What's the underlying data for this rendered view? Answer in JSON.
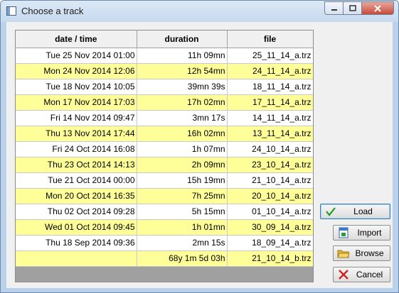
{
  "window": {
    "title": "Choose a track"
  },
  "table": {
    "columns": [
      "date / time",
      "duration",
      "file"
    ],
    "rows": [
      {
        "date": "Tue 25 Nov 2014 01:00",
        "duration": "11h 09mn",
        "file": "25_11_14_a.trz"
      },
      {
        "date": "Mon 24 Nov 2014 12:06",
        "duration": "12h 54mn",
        "file": "24_11_14_a.trz"
      },
      {
        "date": "Tue 18 Nov 2014 10:05",
        "duration": "39mn 39s",
        "file": "18_11_14_a.trz"
      },
      {
        "date": "Mon 17 Nov 2014 17:03",
        "duration": "17h 02mn",
        "file": "17_11_14_a.trz"
      },
      {
        "date": "Fri 14 Nov 2014 09:47",
        "duration": "3mn 17s",
        "file": "14_11_14_a.trz"
      },
      {
        "date": "Thu 13 Nov 2014 17:44",
        "duration": "16h 02mn",
        "file": "13_11_14_a.trz"
      },
      {
        "date": "Fri 24 Oct 2014 16:08",
        "duration": "1h 07mn",
        "file": "24_10_14_a.trz"
      },
      {
        "date": "Thu 23 Oct 2014 14:13",
        "duration": "2h 09mn",
        "file": "23_10_14_a.trz"
      },
      {
        "date": "Tue 21 Oct 2014 00:00",
        "duration": "15h 19mn",
        "file": "21_10_14_a.trz"
      },
      {
        "date": "Mon 20 Oct 2014 16:35",
        "duration": "7h 25mn",
        "file": "20_10_14_a.trz"
      },
      {
        "date": "Thu 02 Oct 2014 09:28",
        "duration": "5h 15mn",
        "file": "01_10_14_a.trz"
      },
      {
        "date": "Wed 01 Oct 2014 09:45",
        "duration": "1h 01mn",
        "file": "30_09_14_a.trz"
      },
      {
        "date": "Thu 18 Sep 2014 09:36",
        "duration": "2mn 15s",
        "file": "18_09_14_a.trz"
      },
      {
        "date": "",
        "duration": "68y 1m 5d 03h",
        "file": "21_10_14_b.trz"
      }
    ]
  },
  "buttons": {
    "load": "Load",
    "import": "Import",
    "browse": "Browse",
    "cancel": "Cancel"
  },
  "colors": {
    "row_alt": "#ffff99",
    "row": "#ffffff",
    "grid_bg": "#a0a0a0"
  },
  "icons": {
    "load": "checkmark-icon",
    "import": "import-icon",
    "browse": "folder-icon",
    "cancel": "x-icon"
  }
}
